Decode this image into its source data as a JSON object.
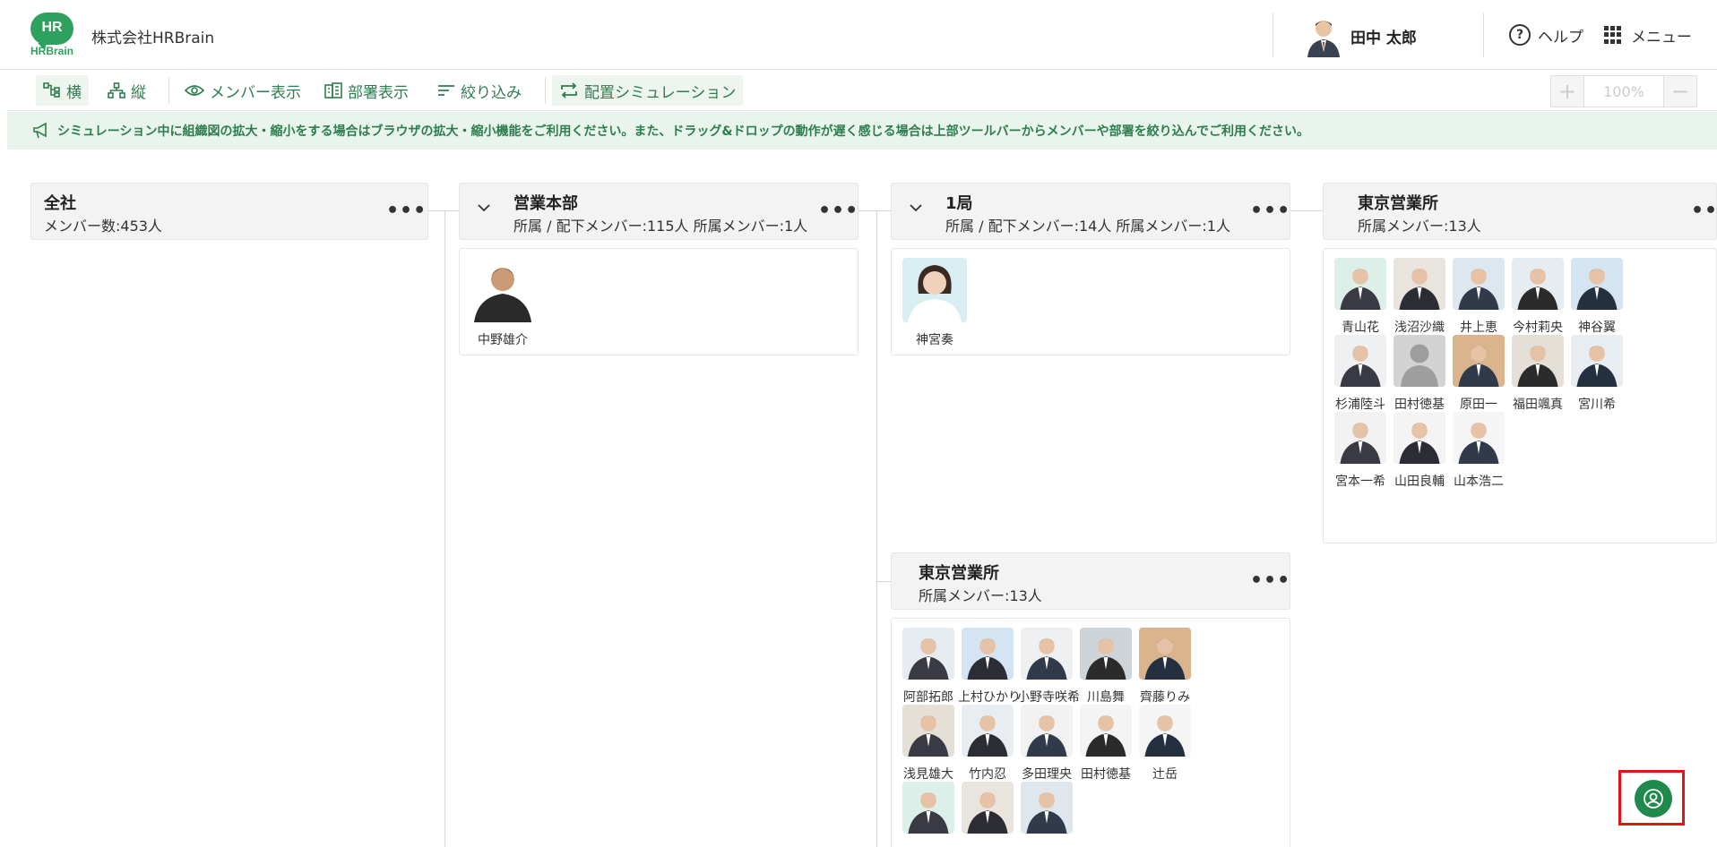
{
  "header": {
    "logo_text": "HR",
    "logo_word": "HRBrain",
    "company": "株式会社HRBrain",
    "user_name": "田中 太郎",
    "help_label": "ヘルプ",
    "menu_label": "メニュー"
  },
  "toolbar": {
    "horizontal_label": "横",
    "vertical_label": "縦",
    "member_view_label": "メンバー表示",
    "dept_view_label": "部署表示",
    "filter_label": "絞り込み",
    "simulation_label": "配置シミュレーション",
    "zoom_in": "+",
    "zoom_value": "100%",
    "zoom_out": "−"
  },
  "notice": {
    "text": "シミュレーション中に組織図の拡大・縮小をする場合はブラウザの拡大・縮小機能をご利用ください。また、ドラッグ&ドロップの動作が遅く感じる場合は上部ツールバーからメンバーや部署を絞り込んでご利用ください。"
  },
  "nodes": {
    "company": {
      "title": "全社",
      "sub": "メンバー数:453人",
      "dots": "•••"
    },
    "hq": {
      "title": "営業本部",
      "sub": "所属 / 配下メンバー:115人 所属メンバー:1人",
      "dots": "•••",
      "members": [
        "中野雄介"
      ]
    },
    "bureau1": {
      "title": "1局",
      "sub": "所属 / 配下メンバー:14人 所属メンバー:1人",
      "dots": "•••",
      "members": [
        "神宮奏"
      ]
    },
    "tokyo_right": {
      "title": "東京営業所",
      "sub": "所属メンバー:13人",
      "dots": "•••",
      "members": [
        "青山花",
        "浅沼沙織",
        "井上恵",
        "今村莉央",
        "神谷翼",
        "杉浦陸斗",
        "田村徳基",
        "原田一",
        "福田颯真",
        "宮川希",
        "宮本一希",
        "山田良輔",
        "山本浩二"
      ]
    },
    "tokyo_lower": {
      "title": "東京営業所",
      "sub": "所属メンバー:13人",
      "dots": "•••",
      "members": [
        "阿部拓郎",
        "上村ひかり",
        "小野寺咲希",
        "川島舞",
        "齊藤りみ",
        "浅見雄大",
        "竹内忍",
        "多田理央",
        "田村徳基",
        "辻岳",
        "",
        "",
        ""
      ]
    }
  },
  "colors": {
    "brand": "#2fa15f",
    "accent_text": "#2e7d4f",
    "fab": "#1f8a4c",
    "highlight": "#e01515"
  }
}
